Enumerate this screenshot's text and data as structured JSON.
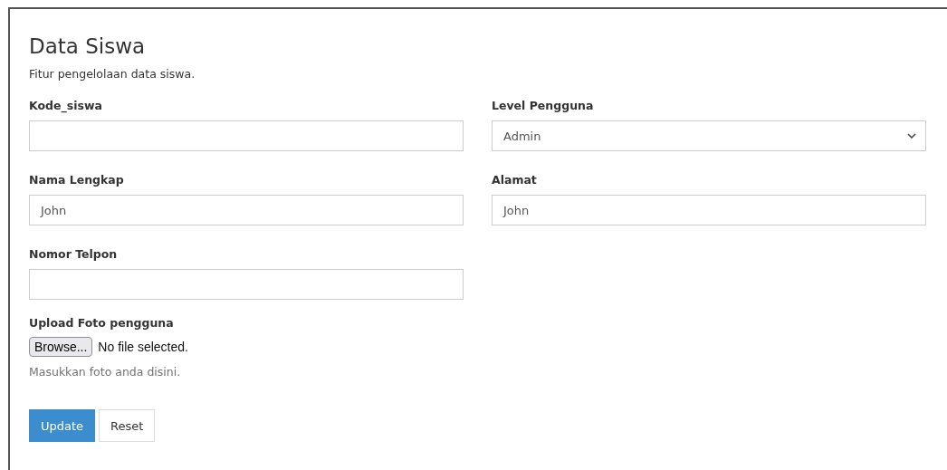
{
  "panel": {
    "title": "Data Siswa",
    "subtitle": "Fitur pengelolaan data siswa."
  },
  "rows": [
    [
      {
        "label": "Kode_siswa",
        "kind": "text"
      },
      {
        "label": "Level Pengguna",
        "kind": "select",
        "value": "Admin"
      }
    ],
    [
      {
        "label": "Nama Lengkap",
        "kind": "text",
        "value": "John"
      },
      {
        "label": "Alamat",
        "kind": "text",
        "value": "John"
      }
    ],
    [
      {
        "label": "Nomor Telpon",
        "kind": "text"
      }
    ]
  ],
  "upload": {
    "label": "Upload Foto pengguna",
    "button": "Browse...",
    "status": "No file selected.",
    "help": "Masukkan foto anda disini."
  },
  "buttons": [
    {
      "label": "Update",
      "kind": "primary"
    },
    {
      "label": "Reset",
      "kind": "default"
    }
  ]
}
